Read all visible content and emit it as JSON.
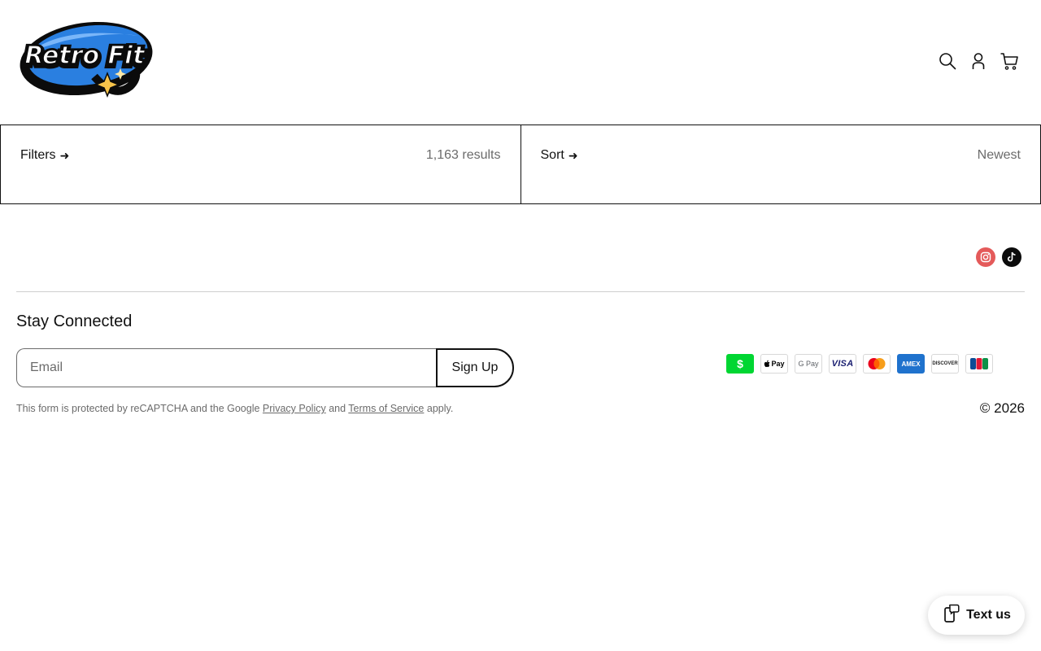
{
  "header": {
    "logo_text": "Retro Fit",
    "icons": [
      "search-icon",
      "account-icon",
      "cart-icon"
    ]
  },
  "bar": {
    "filters_label": "Filters",
    "results_text": "1,163 results",
    "sort_label": "Sort",
    "sort_value": "Newest",
    "arrow": "➜"
  },
  "social": {
    "icons": [
      "instagram-icon",
      "tiktok-icon"
    ],
    "colors": {
      "instagram": "#e45a5a",
      "tiktok": "#0b0b0b"
    }
  },
  "newsletter": {
    "heading": "Stay Connected",
    "email_placeholder": "Email",
    "signup_label": "Sign Up",
    "legal_prefix": "This form is protected by reCAPTCHA and the Google ",
    "privacy_link": "Privacy Policy",
    "legal_and": " and ",
    "terms_link": "Terms of Service",
    "legal_suffix": " apply."
  },
  "payments": {
    "cashapp": "$",
    "applepay": " Pay",
    "gpay": "G Pay",
    "visa": "VISA",
    "amex": "AMEX",
    "discover": "DISCOVER"
  },
  "footer": {
    "copyright": "© 2026"
  },
  "widget": {
    "text_us_label": "Text us"
  }
}
